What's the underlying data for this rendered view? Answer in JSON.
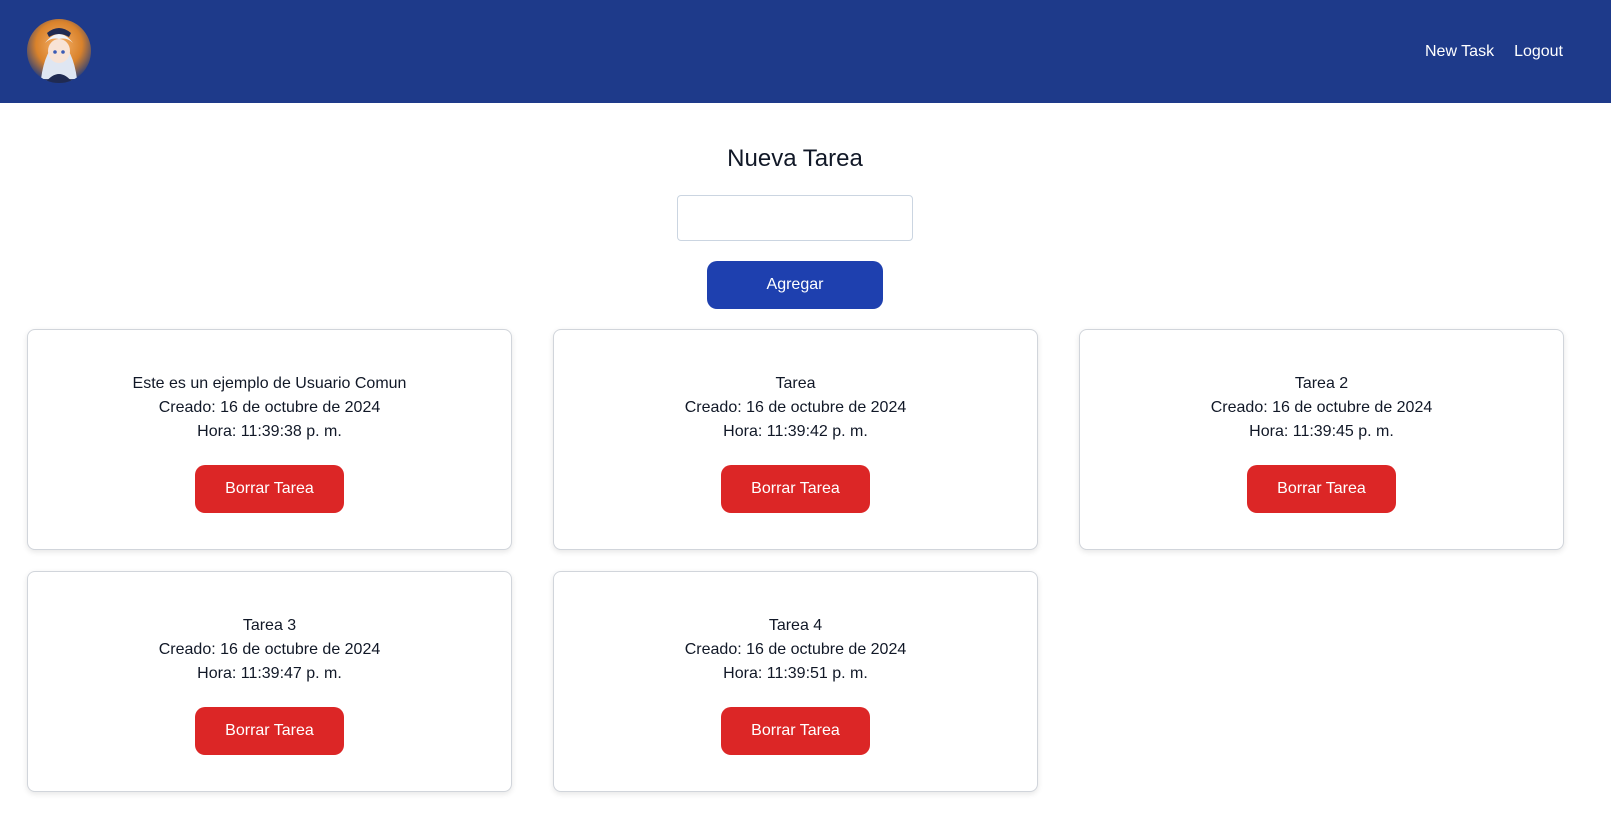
{
  "nav": {
    "avatar_alt": "user avatar",
    "links": [
      "New Task",
      "Logout"
    ]
  },
  "form": {
    "title": "Nueva Tarea",
    "input_value": "",
    "input_placeholder": "",
    "add_label": "Agregar"
  },
  "tasks": [
    {
      "name": "Este es un ejemplo de Usuario Comun",
      "created": "Creado: 16 de octubre de 2024",
      "time": "Hora: 11:39:38 p. m.",
      "delete_label": "Borrar Tarea"
    },
    {
      "name": "Tarea",
      "created": "Creado: 16 de octubre de 2024",
      "time": "Hora: 11:39:42 p. m.",
      "delete_label": "Borrar Tarea"
    },
    {
      "name": "Tarea 2",
      "created": "Creado: 16 de octubre de 2024",
      "time": "Hora: 11:39:45 p. m.",
      "delete_label": "Borrar Tarea"
    },
    {
      "name": "Tarea 3",
      "created": "Creado: 16 de octubre de 2024",
      "time": "Hora: 11:39:47 p. m.",
      "delete_label": "Borrar Tarea"
    },
    {
      "name": "Tarea 4",
      "created": "Creado: 16 de octubre de 2024",
      "time": "Hora: 11:39:51 p. m.",
      "delete_label": "Borrar Tarea"
    }
  ],
  "colors": {
    "navbar": "#1e3a8a",
    "primary_button": "#1e40af",
    "danger_button": "#dc2626"
  }
}
